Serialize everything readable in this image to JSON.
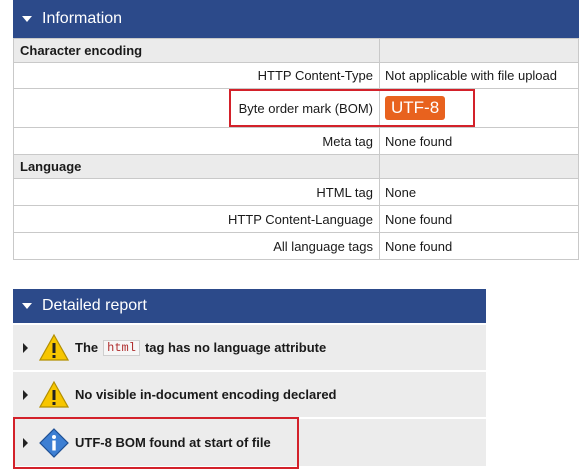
{
  "info": {
    "title": "Information",
    "sections": [
      {
        "name": "Character encoding",
        "rows": [
          {
            "label": "HTTP Content-Type",
            "value": "Not applicable with file upload"
          },
          {
            "label": "Byte order mark (BOM)",
            "value": "UTF-8"
          },
          {
            "label": "Meta tag",
            "value": "None found"
          }
        ]
      },
      {
        "name": "Language",
        "rows": [
          {
            "label": "HTML tag",
            "value": "None"
          },
          {
            "label": "HTTP Content-Language",
            "value": "None found"
          },
          {
            "label": "All language tags",
            "value": "None found"
          }
        ]
      }
    ]
  },
  "report": {
    "title": "Detailed report",
    "items": [
      {
        "icon": "warning-icon",
        "pre": "The",
        "code": "html",
        "post": "tag has no language attribute"
      },
      {
        "icon": "warning-icon",
        "text": "No visible in-document encoding declared"
      },
      {
        "icon": "info-icon",
        "text": "UTF-8 BOM found at start of file"
      }
    ]
  },
  "colors": {
    "header": "#2c4a8a",
    "badge": "#e8621e",
    "highlight": "#d3212a"
  }
}
